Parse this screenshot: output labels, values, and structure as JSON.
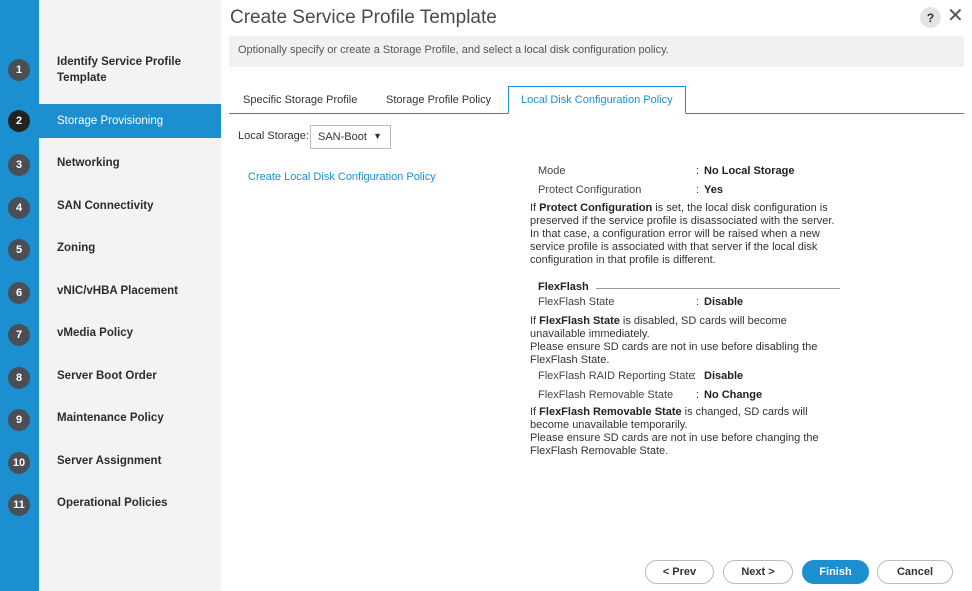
{
  "wizard": {
    "title": "Create Service Profile Template",
    "help_label": "?",
    "close_label": "✕",
    "description": "Optionally specify or create a Storage Profile, and select a local disk configuration policy."
  },
  "steps": [
    {
      "num": "1",
      "label": "Identify Service Profile Template",
      "active": false
    },
    {
      "num": "2",
      "label": "Storage Provisioning",
      "active": true
    },
    {
      "num": "3",
      "label": "Networking",
      "active": false
    },
    {
      "num": "4",
      "label": "SAN Connectivity",
      "active": false
    },
    {
      "num": "5",
      "label": "Zoning",
      "active": false
    },
    {
      "num": "6",
      "label": "vNIC/vHBA Placement",
      "active": false
    },
    {
      "num": "7",
      "label": "vMedia Policy",
      "active": false
    },
    {
      "num": "8",
      "label": "Server Boot Order",
      "active": false
    },
    {
      "num": "9",
      "label": "Maintenance Policy",
      "active": false
    },
    {
      "num": "10",
      "label": "Server Assignment",
      "active": false
    },
    {
      "num": "11",
      "label": "Operational Policies",
      "active": false
    }
  ],
  "tabs": [
    {
      "label": "Specific Storage Profile",
      "active": false
    },
    {
      "label": "Storage Profile Policy",
      "active": false
    },
    {
      "label": "Local Disk Configuration Policy",
      "active": true
    }
  ],
  "local_storage": {
    "label": "Local Storage:",
    "selected": "SAN-Boot",
    "caret": "▼"
  },
  "create_link": "Create Local Disk Configuration Policy",
  "details": {
    "mode": {
      "key": "Mode",
      "sep": ":",
      "value": "No Local Storage"
    },
    "protect": {
      "key": "Protect Configuration",
      "sep": ":",
      "value": "Yes"
    },
    "protect_note": {
      "prefix": "If ",
      "bold": "Protect Configuration",
      "rest": " is set, the local disk configuration is preserved if the service profile is disassociated with the server. In that case, a configuration error will be raised when a new service profile is associated with that server if the local disk configuration in that profile is different."
    },
    "flexflash_header": "FlexFlash",
    "flexflash_state": {
      "key": "FlexFlash State",
      "sep": ":",
      "value": "Disable"
    },
    "flexflash_note": {
      "prefix": "If ",
      "bold": "FlexFlash State",
      "rest": " is disabled, SD cards will become unavailable immediately.",
      "line2": "Please ensure SD cards are not in use before disabling the FlexFlash State."
    },
    "raid_reporting": {
      "key": "FlexFlash RAID Reporting State",
      "sep": ":",
      "value": "Disable"
    },
    "removable": {
      "key": "FlexFlash Removable State",
      "sep": ":",
      "value": "No Change"
    },
    "removable_note": {
      "prefix": "If ",
      "bold": "FlexFlash Removable State",
      "rest": " is changed, SD cards will become unavailable temporarily.",
      "line2": "Please ensure SD cards are not in use before changing the FlexFlash Removable State."
    }
  },
  "footer": {
    "prev_label": "< Prev",
    "next_label": "Next >",
    "finish_label": "Finish",
    "cancel_label": "Cancel"
  },
  "colors": {
    "accent": "#1b8fd0"
  }
}
